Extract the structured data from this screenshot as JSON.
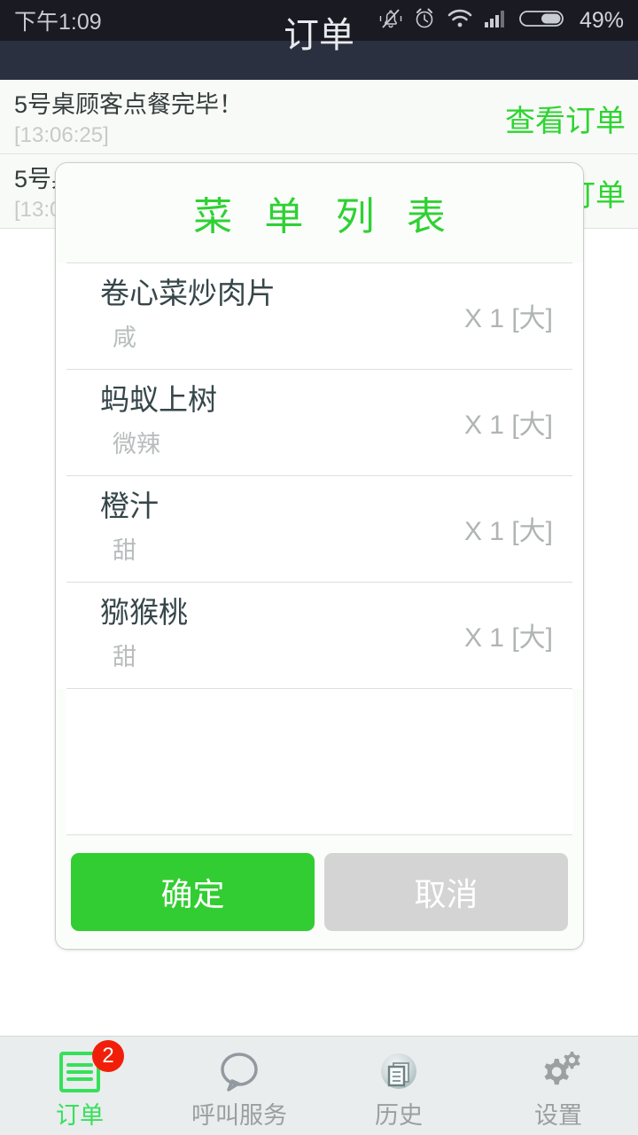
{
  "status_bar": {
    "time": "下午1:09",
    "battery_percent": "49%",
    "icons": [
      "mute-bell-icon",
      "alarm-clock-icon",
      "wifi-icon",
      "signal-bars-icon",
      "battery-icon"
    ]
  },
  "app_bar": {
    "title": "订单"
  },
  "order_list": [
    {
      "message": "5号桌顾客点餐完毕！",
      "time": "[13:06:25]",
      "action": "查看订单"
    },
    {
      "message": "5号桌顾客点餐完毕！",
      "time": "[13:05:42]",
      "action": "查看订单"
    }
  ],
  "dialog": {
    "title": "菜 单 列 表",
    "dishes": [
      {
        "name": "卷心菜炒肉片",
        "taste": "咸",
        "qty": "X 1 [大]"
      },
      {
        "name": "蚂蚁上树",
        "taste": "微辣",
        "qty": "X 1 [大]"
      },
      {
        "name": "橙汁",
        "taste": "甜",
        "qty": "X 1 [大]"
      },
      {
        "name": "猕猴桃",
        "taste": "甜",
        "qty": "X 1 [大]"
      }
    ],
    "confirm_label": "确定",
    "cancel_label": "取消"
  },
  "bottom_nav": {
    "items": [
      {
        "label": "订单",
        "icon": "list-icon",
        "badge": "2",
        "active": true
      },
      {
        "label": "呼叫服务",
        "icon": "speech-bubble-icon",
        "badge": "",
        "active": false
      },
      {
        "label": "历史",
        "icon": "document-icon",
        "badge": "",
        "active": false
      },
      {
        "label": "设置",
        "icon": "gears-icon",
        "badge": "",
        "active": false
      }
    ]
  },
  "colors": {
    "accent_green": "#2ed430",
    "status_bar_bg": "#191a22",
    "app_bar_bg": "#2b3040",
    "badge_red": "#f11f09",
    "cancel_gray": "#d4d4d4"
  }
}
